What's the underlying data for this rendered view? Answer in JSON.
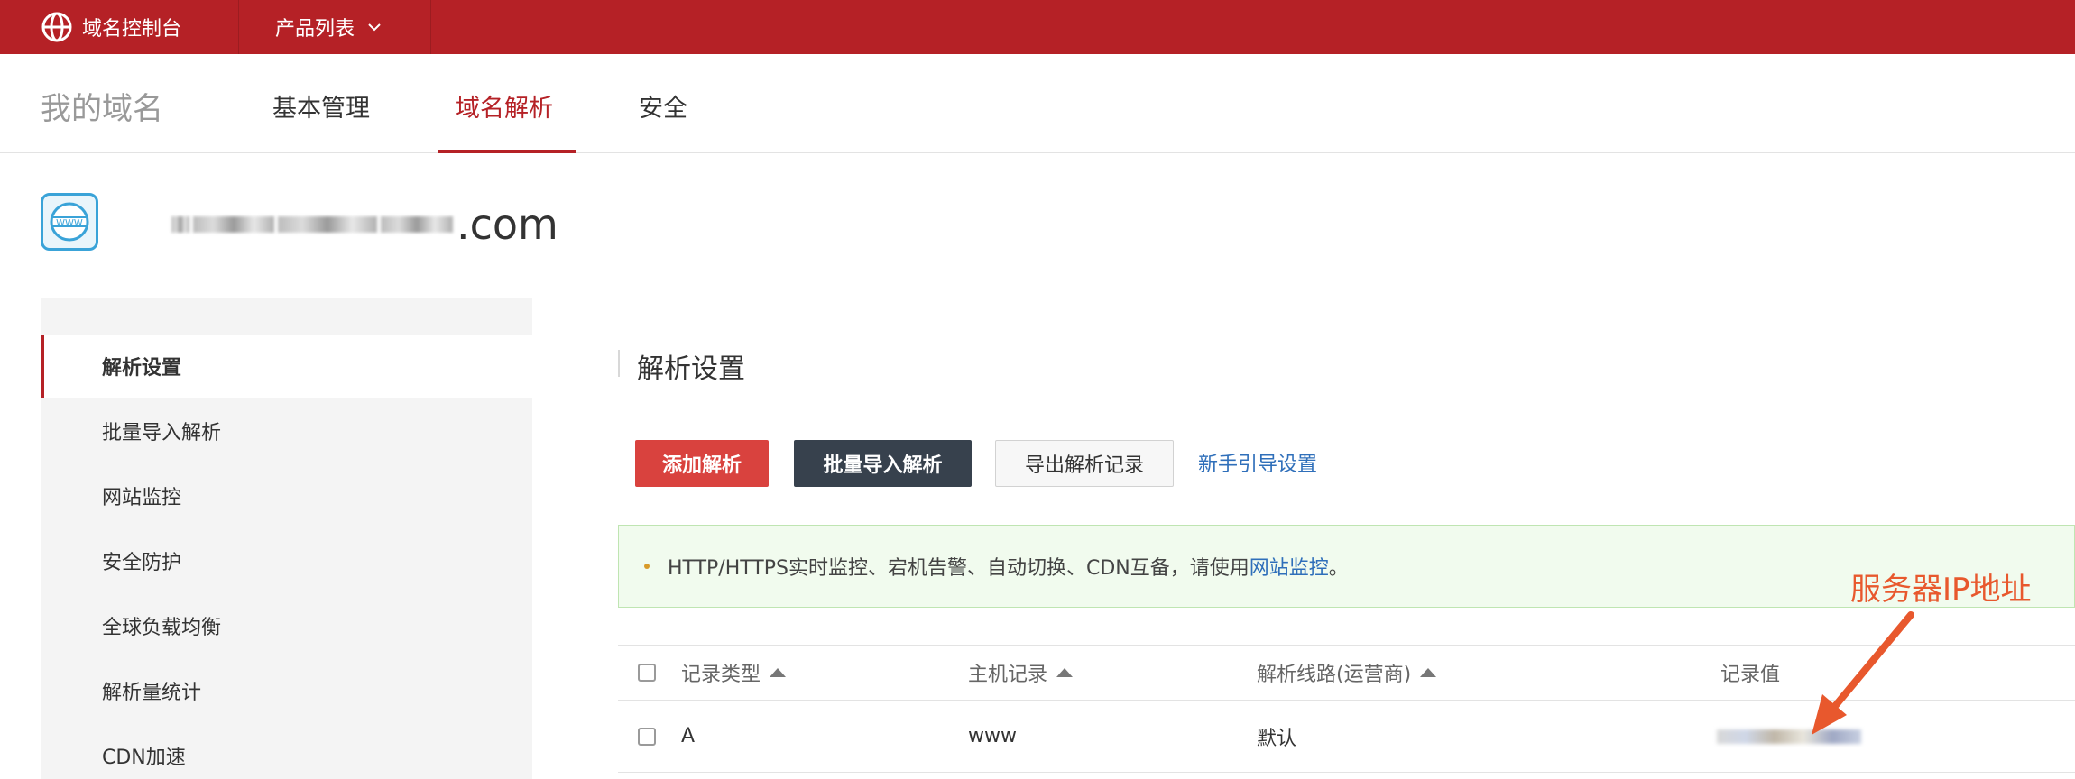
{
  "topbar": {
    "brand_label": "域名控制台",
    "products_label": "产品列表"
  },
  "subnav": {
    "title": "我的域名",
    "tabs": [
      {
        "label": "基本管理",
        "active": false
      },
      {
        "label": "域名解析",
        "active": true
      },
      {
        "label": "安全",
        "active": false
      }
    ]
  },
  "domain": {
    "visible_suffix": ".com"
  },
  "sidebar": {
    "items": [
      {
        "label": "解析设置",
        "active": true
      },
      {
        "label": "批量导入解析",
        "active": false
      },
      {
        "label": "网站监控",
        "active": false
      },
      {
        "label": "安全防护",
        "active": false
      },
      {
        "label": "全球负载均衡",
        "active": false
      },
      {
        "label": "解析量统计",
        "active": false
      },
      {
        "label": "CDN加速",
        "active": false
      }
    ]
  },
  "main": {
    "section_title": "解析设置",
    "buttons": {
      "add": "添加解析",
      "batch": "批量导入解析",
      "export": "导出解析记录"
    },
    "guide_link": "新手引导设置",
    "notice": {
      "text": "HTTP/HTTPS实时监控、宕机告警、自动切换、CDN互备，请使用 ",
      "link": "网站监控",
      "suffix": "。"
    },
    "annotation": "服务器IP地址",
    "table": {
      "headers": [
        "记录类型",
        "主机记录",
        "解析线路(运营商)",
        "记录值"
      ],
      "rows": [
        {
          "type": "A",
          "host": "www",
          "line": "默认"
        }
      ]
    }
  },
  "colors": {
    "brand_red": "#b52126",
    "add_button": "#d9423e",
    "batch_button": "#37414d",
    "link_blue": "#2f6fba",
    "annotation_orange": "#e8582d"
  }
}
